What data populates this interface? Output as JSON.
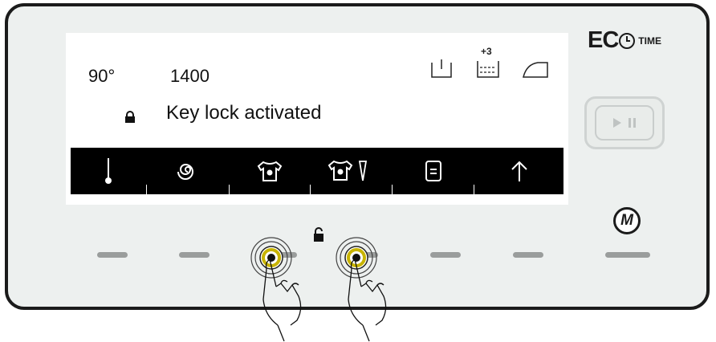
{
  "display": {
    "temperature": "90°",
    "spin": "1400",
    "status": "Key lock activated",
    "top_icons": [
      "prewash-icon",
      "extra-rinse-icon",
      "easy-iron-icon"
    ],
    "extra_rinse_label": "+3",
    "menu_icons": [
      "temperature-icon",
      "spin-icon",
      "stain-icon",
      "stain-plus-icon",
      "options-icon",
      "up-arrow-icon"
    ]
  },
  "brand": {
    "eco": "EC",
    "time": "TIME"
  },
  "buttons": {
    "play_pause": "play-pause-icon",
    "menu_label": "M"
  },
  "colors": {
    "panel_bg": "#edf0ef",
    "border": "#1b1b1b",
    "key": "#9a9d9c",
    "highlight": "#c8b400"
  }
}
